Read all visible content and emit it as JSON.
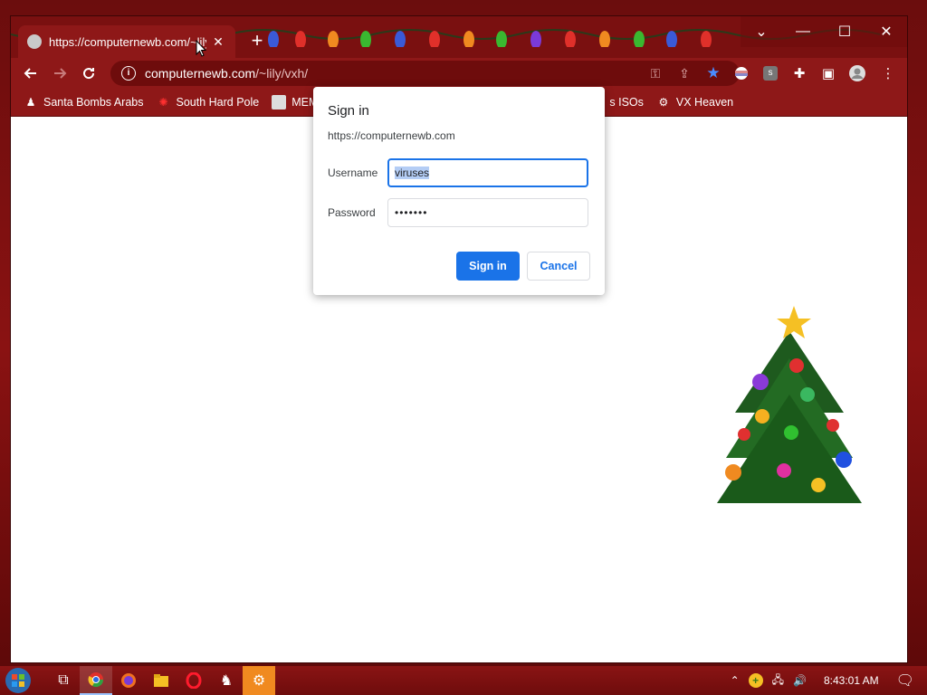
{
  "browser": {
    "tab": {
      "title": "https://computernewb.com/~lily"
    },
    "address_bar": {
      "domain": "computernewb.com",
      "path": "/~lily/vxh/"
    },
    "bookmarks": [
      {
        "label": "Santa Bombs Arabs",
        "icon": "figure-icon"
      },
      {
        "label": "South Hard Pole",
        "icon": "red-star-icon"
      },
      {
        "label": "MEM",
        "icon": "image-icon"
      },
      {
        "label": "s ISOs",
        "icon": "none"
      },
      {
        "label": "VX Heaven",
        "icon": "vx-icon"
      }
    ]
  },
  "dialog": {
    "title": "Sign in",
    "origin": "https://computernewb.com",
    "username_label": "Username",
    "username_value": "viruses",
    "password_label": "Password",
    "password_value": "•••••••",
    "signin_label": "Sign in",
    "cancel_label": "Cancel"
  },
  "taskbar": {
    "time": "8:43:01 AM"
  },
  "colors": {
    "theme": "#8e1818",
    "accent": "#1a73e8"
  }
}
